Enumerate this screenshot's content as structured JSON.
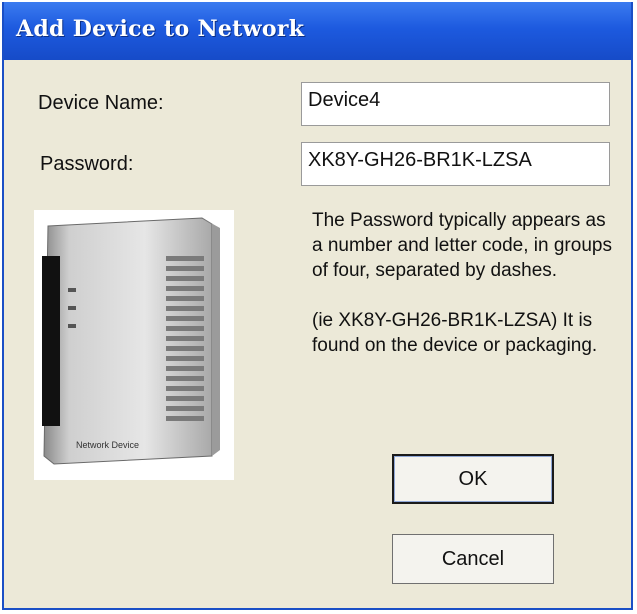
{
  "window": {
    "title": "Add Device to Network"
  },
  "form": {
    "device_name_label": "Device Name:",
    "device_name_value": "Device4",
    "password_label": "Password:",
    "password_value": "XK8Y-GH26-BR1K-LZSA"
  },
  "help": {
    "line1": "The Password typically appears as a number and letter code, in groups of four, separated by dashes.",
    "line2": "(ie XK8Y-GH26-BR1K-LZSA) It is found on the device or packaging."
  },
  "buttons": {
    "ok_label": "OK",
    "cancel_label": "Cancel"
  },
  "image": {
    "icon": "network-device-icon",
    "caption": "Network Device"
  },
  "colors": {
    "title_bar": "#1D5ADF",
    "dialog_background": "#ECE9D8"
  }
}
